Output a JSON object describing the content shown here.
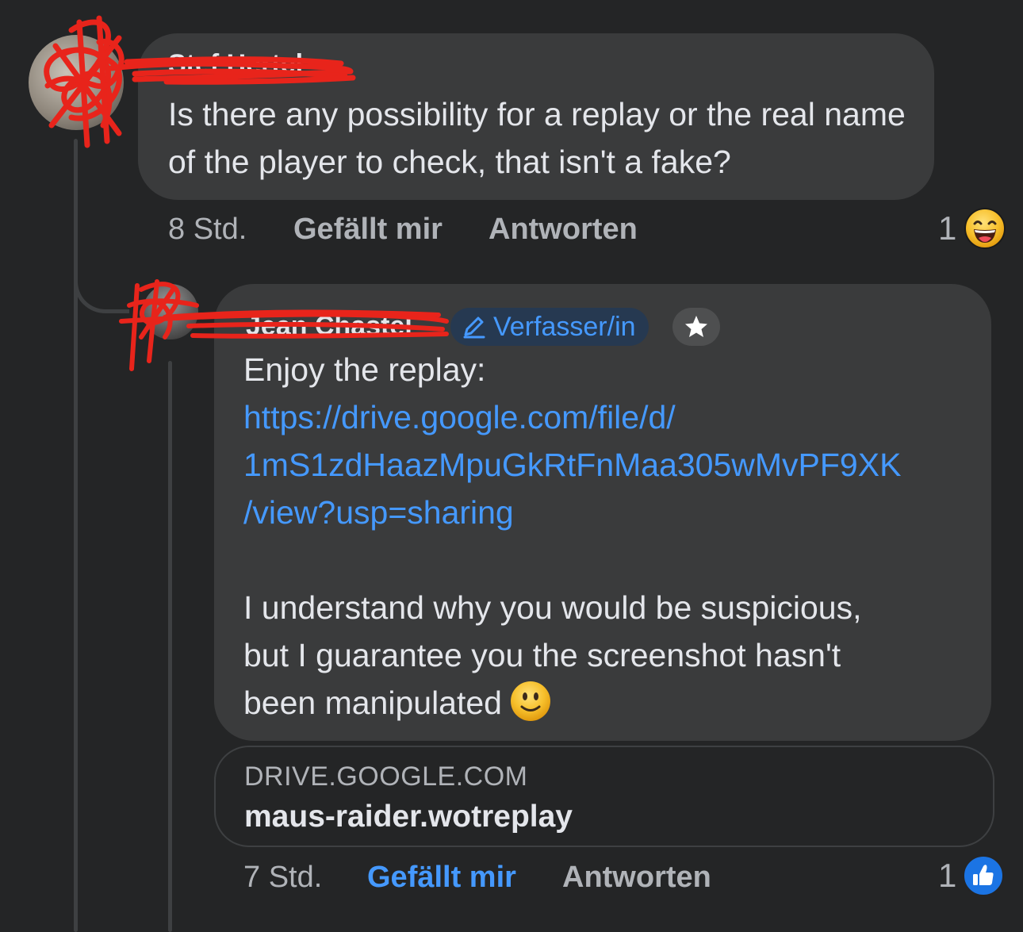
{
  "comment": {
    "author": "Stef Hertel",
    "text": "Is there any possibility for a replay or the real name of the player to check, that isn't a fake?",
    "time": "8 Std.",
    "like_label": "Gefällt mir",
    "reply_label": "Antworten",
    "reaction_count": "1",
    "reaction_icon": "laughing-emoji-icon"
  },
  "reply": {
    "author": "Jean Chastel",
    "badge": "Verfasser/in",
    "line_1": "Enjoy the replay:",
    "link_lines": [
      "https://drive.google.com/file/d/",
      "1mS1zdHaazMpuGkRtFnMaa305wMvPF9XK",
      "/view?usp=sharing"
    ],
    "para_lines": [
      "I understand why you would be suspicious,",
      "but I guarantee you the screenshot hasn't",
      "been manipulated"
    ],
    "emoji": "slightly-smiling-emoji-icon",
    "preview": {
      "domain": "DRIVE.GOOGLE.COM",
      "title": "maus-raider.wotreplay"
    },
    "time": "7 Std.",
    "like_label": "Gefällt mir",
    "reply_label": "Antworten",
    "reaction_count": "1",
    "reaction_icon": "like-thumb-icon"
  },
  "colors": {
    "background": "#242526",
    "bubble": "#3a3b3c",
    "link": "#4599ff",
    "redaction": "#e8241b"
  }
}
